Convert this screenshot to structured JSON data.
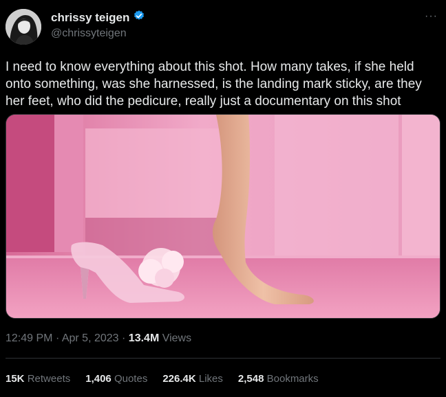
{
  "author": {
    "display_name": "chrissy teigen",
    "handle": "@chrissyteigen",
    "verified": true
  },
  "more_label": "···",
  "tweet_text": "I need to know everything about this shot. How many takes, if she held onto something, was she harnessed, is the landing mark sticky, are they her feet, who did the pedicure, really just a documentary on this shot",
  "meta": {
    "time": "12:49 PM",
    "date": "Apr 5, 2023",
    "sep": "·",
    "views_count": "13.4M",
    "views_label": "Views"
  },
  "stats": [
    {
      "count": "15K",
      "label": "Retweets"
    },
    {
      "count": "1,406",
      "label": "Quotes"
    },
    {
      "count": "226.4K",
      "label": "Likes"
    },
    {
      "count": "2,548",
      "label": "Bookmarks"
    }
  ],
  "colors": {
    "background": "#000000",
    "text": "#e7e9ea",
    "secondary": "#71767b",
    "verified": "#1d9bf0",
    "image_pink": "#e38bb2"
  },
  "icons": [
    "verified-badge-icon",
    "more-icon"
  ]
}
